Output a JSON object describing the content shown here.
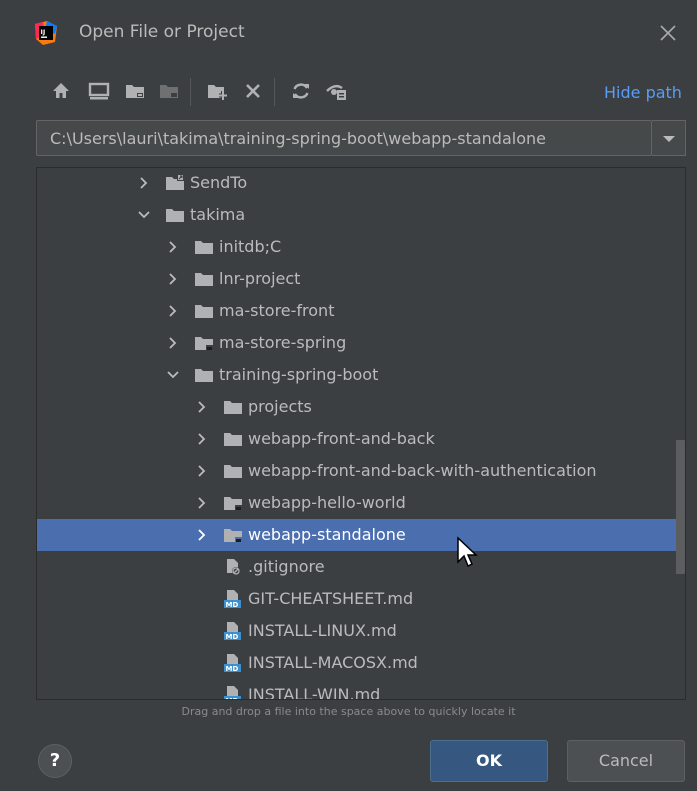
{
  "window": {
    "title": "Open File or Project",
    "app_icon": "intellij-idea-icon",
    "close_icon": "close-icon"
  },
  "toolbar": {
    "buttons": [
      {
        "icon": "home-icon"
      },
      {
        "icon": "desktop-icon"
      },
      {
        "icon": "project-folder-icon"
      },
      {
        "icon": "module-folder-icon"
      },
      {
        "icon": "new-folder-icon"
      },
      {
        "icon": "delete-icon"
      },
      {
        "icon": "refresh-icon"
      },
      {
        "icon": "show-hidden-icon"
      }
    ],
    "hide_path_label": "Hide path"
  },
  "path": {
    "value": "C:\\Users\\lauri\\takima\\training-spring-boot\\webapp-standalone"
  },
  "tree": {
    "items": [
      {
        "label": "SendTo",
        "expanded": false,
        "type": "shortcut-folder"
      },
      {
        "label": "takima",
        "expanded": true,
        "type": "folder"
      },
      {
        "label": "initdb;C",
        "expanded": false,
        "type": "folder"
      },
      {
        "label": "lnr-project",
        "expanded": false,
        "type": "folder"
      },
      {
        "label": "ma-store-front",
        "expanded": false,
        "type": "folder"
      },
      {
        "label": "ma-store-spring",
        "expanded": false,
        "type": "project-folder"
      },
      {
        "label": "training-spring-boot",
        "expanded": true,
        "type": "folder"
      },
      {
        "label": "projects",
        "expanded": false,
        "type": "folder"
      },
      {
        "label": "webapp-front-and-back",
        "expanded": false,
        "type": "folder"
      },
      {
        "label": "webapp-front-and-back-with-authentication",
        "expanded": false,
        "type": "folder"
      },
      {
        "label": "webapp-hello-world",
        "expanded": false,
        "type": "project-folder"
      },
      {
        "label": "webapp-standalone",
        "expanded": false,
        "type": "project-folder",
        "selected": true
      },
      {
        "label": ".gitignore",
        "type": "ignore-file"
      },
      {
        "label": "GIT-CHEATSHEET.md",
        "type": "md-file"
      },
      {
        "label": "INSTALL-LINUX.md",
        "type": "md-file"
      },
      {
        "label": "INSTALL-MACOSX.md",
        "type": "md-file"
      },
      {
        "label": "INSTALL-WIN.md",
        "type": "md-file"
      }
    ]
  },
  "footer": {
    "hint": "Drag and drop a file into the space above to quickly locate it",
    "help_label": "?",
    "ok_label": "OK",
    "cancel_label": "Cancel"
  },
  "colors": {
    "background": "#3c3f41",
    "selection": "#4b6eaf",
    "link": "#589df6",
    "ok_button": "#365880"
  }
}
